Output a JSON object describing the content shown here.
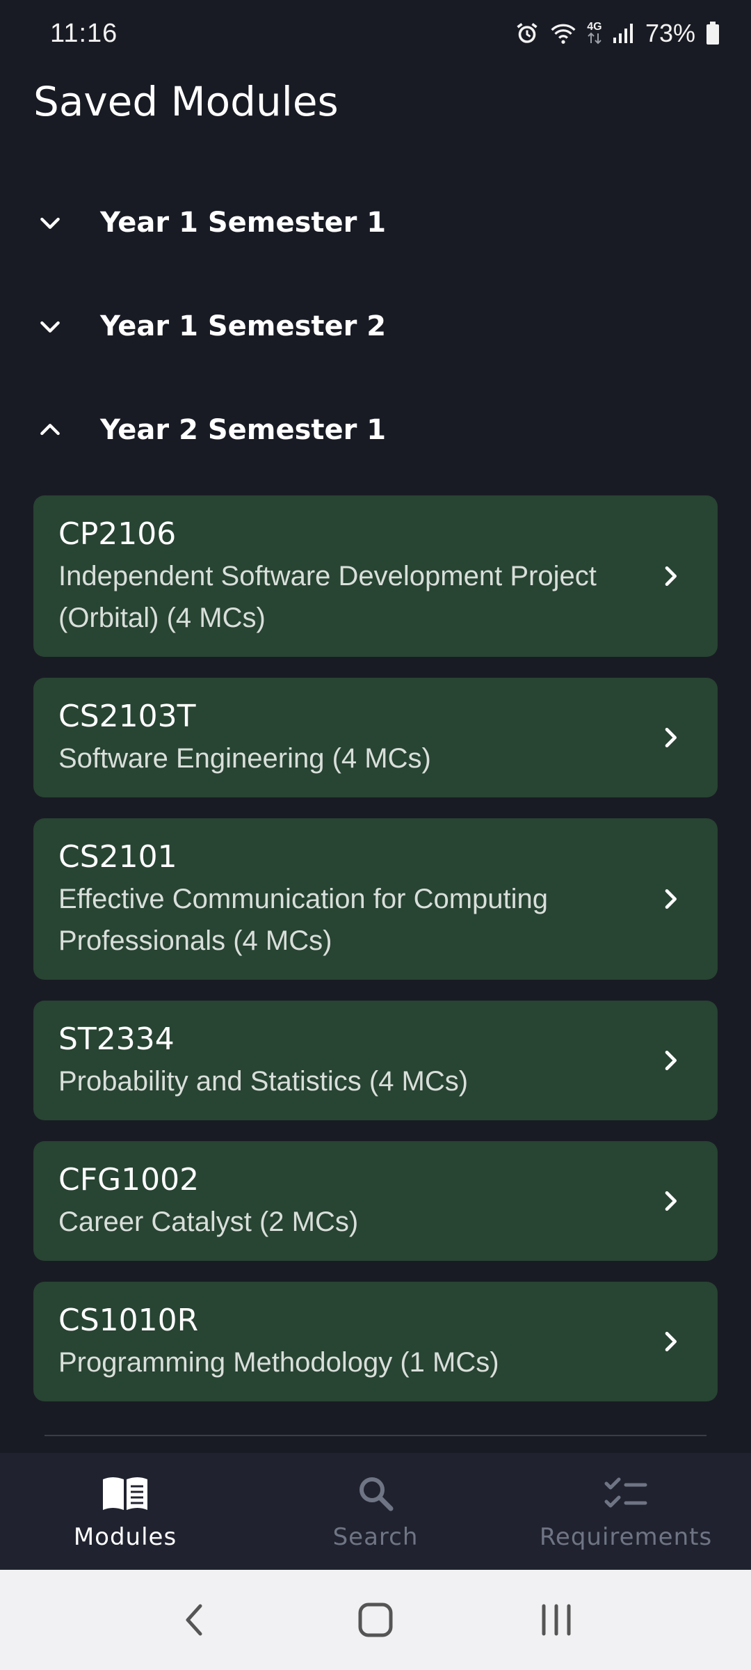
{
  "status_bar": {
    "time": "11:16",
    "network": "4G",
    "battery": "73%",
    "icons": [
      "alarm-icon",
      "wifi-icon",
      "network-4g-icon",
      "signal-icon",
      "battery-icon"
    ]
  },
  "header": {
    "title": "Saved Modules"
  },
  "semesters": [
    {
      "label": "Year 1 Semester 1",
      "expanded": false,
      "chevron": "chevron-down-icon"
    },
    {
      "label": "Year 1 Semester 2",
      "expanded": false,
      "chevron": "chevron-down-icon"
    },
    {
      "label": "Year 2 Semester 1",
      "expanded": true,
      "chevron": "chevron-up-icon"
    }
  ],
  "modules": [
    {
      "code": "CP2106",
      "title": "Independent Software Development Project (Orbital) (4 MCs)"
    },
    {
      "code": "CS2103T",
      "title": "Software Engineering (4 MCs)"
    },
    {
      "code": "CS2101",
      "title": "Effective Communication for Computing Professionals (4 MCs)"
    },
    {
      "code": "ST2334",
      "title": "Probability and Statistics (4 MCs)"
    },
    {
      "code": "CFG1002",
      "title": "Career Catalyst (2 MCs)"
    },
    {
      "code": "CS1010R",
      "title": "Programming Methodology (1 MCs)"
    }
  ],
  "bottom_nav": {
    "items": [
      {
        "label": "Modules",
        "icon": "book-icon",
        "active": true
      },
      {
        "label": "Search",
        "icon": "search-icon",
        "active": false
      },
      {
        "label": "Requirements",
        "icon": "checklist-icon",
        "active": false
      }
    ]
  },
  "colors": {
    "background": "#191b24",
    "card": "#284433",
    "nav_background": "#20232f",
    "active": "#ffffff",
    "inactive": "#6f7584"
  }
}
